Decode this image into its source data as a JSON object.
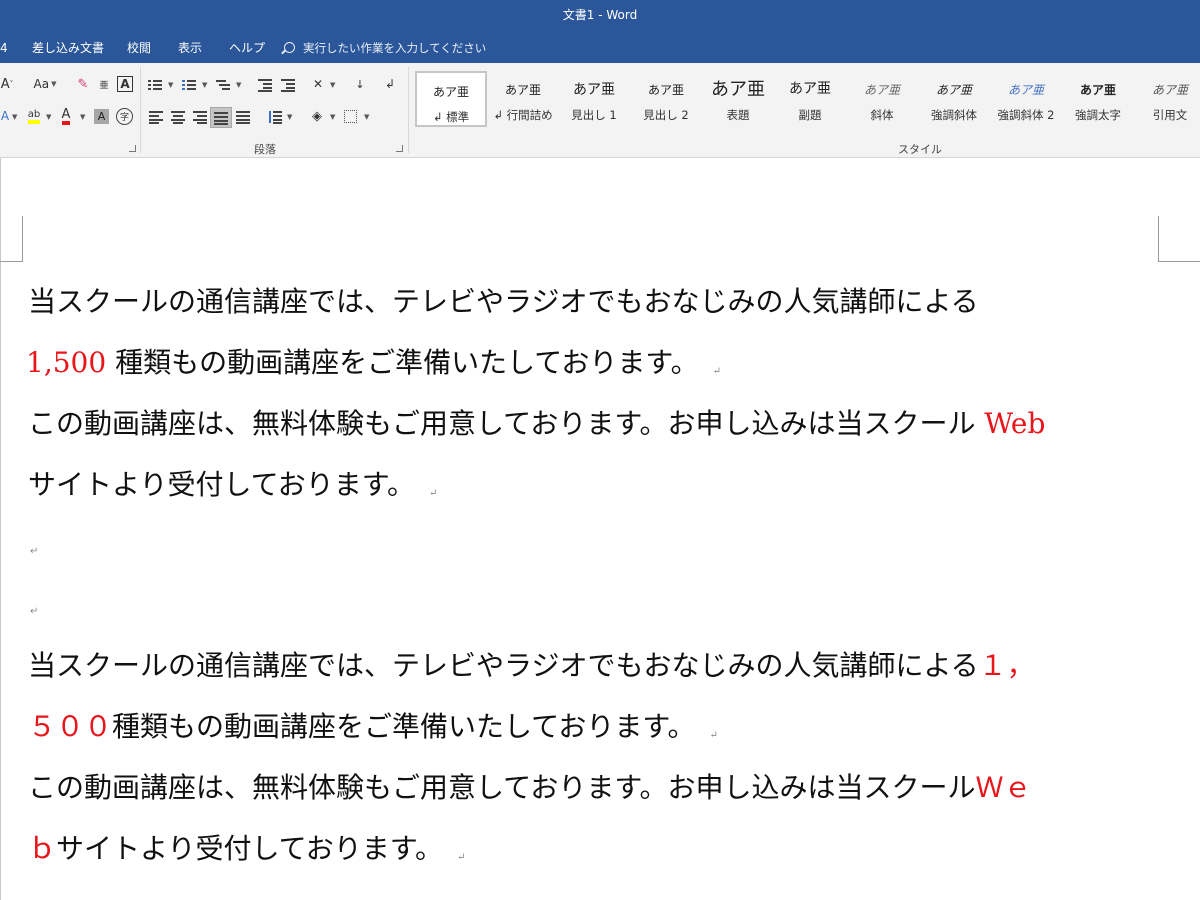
{
  "window": {
    "title": "文書1  -  Word"
  },
  "tabs": {
    "partial": "4",
    "mailings": "差し込み文書",
    "review": "校閲",
    "view": "表示",
    "help": "ヘルプ",
    "tell_me": "実行したい作業を入力してください"
  },
  "ribbon": {
    "font_group": {
      "change_case": "Aa",
      "char_border": "A",
      "text_effects": "A",
      "highlight": "ab",
      "font_color": "A",
      "char_shading": "A",
      "enclosed_char": "字",
      "phonetic": "亜"
    },
    "paragraph_group": {
      "label": "段落"
    },
    "styles_group": {
      "label": "スタイル",
      "items": [
        {
          "sample": "あア亜",
          "name": "↲ 標準",
          "selected": true
        },
        {
          "sample": "あア亜",
          "name": "↲ 行間詰め"
        },
        {
          "sample": "あア亜",
          "name": "見出し 1"
        },
        {
          "sample": "あア亜",
          "name": "見出し 2"
        },
        {
          "sample": "あア亜",
          "name": "表題"
        },
        {
          "sample": "あア亜",
          "name": "副題"
        },
        {
          "sample": "あア亜",
          "name": "斜体"
        },
        {
          "sample": "あア亜",
          "name": "強調斜体"
        },
        {
          "sample": "あア亜",
          "name": "強調斜体 2"
        },
        {
          "sample": "あア亜",
          "name": "強調太字"
        },
        {
          "sample": "あア亜",
          "name": "引用文"
        }
      ]
    }
  },
  "document": {
    "para_mark": "↵",
    "lines": {
      "l1": "当スクールの通信講座では、テレビやラジオでもおなじみの人気講師による",
      "l2_red": "1,500",
      "l2": " 種類もの動画講座をご準備いたしております。",
      "l3": "この動画講座は、無料体験もご用意しております。お申し込みは当スクール",
      "l3_red": " Web",
      "l4": "サイトより受付しております。",
      "l5": "当スクールの通信講座では、テレビやラジオでもおなじみの人気講師による",
      "l5_red": "１，",
      "l6_red": "５００",
      "l6": "種類もの動画講座をご準備いたしております。",
      "l7": "この動画講座は、無料体験もご用意しております。お申し込みは当スクール",
      "l7_red": "Ｗｅ",
      "l8_red": "ｂ",
      "l8": "サイトより受付しております。"
    }
  },
  "colors": {
    "titlebar": "#2b579a",
    "ribbon": "#f3f3f3",
    "accent_red": "#e8151b",
    "highlight_yellow": "#ffff00"
  }
}
